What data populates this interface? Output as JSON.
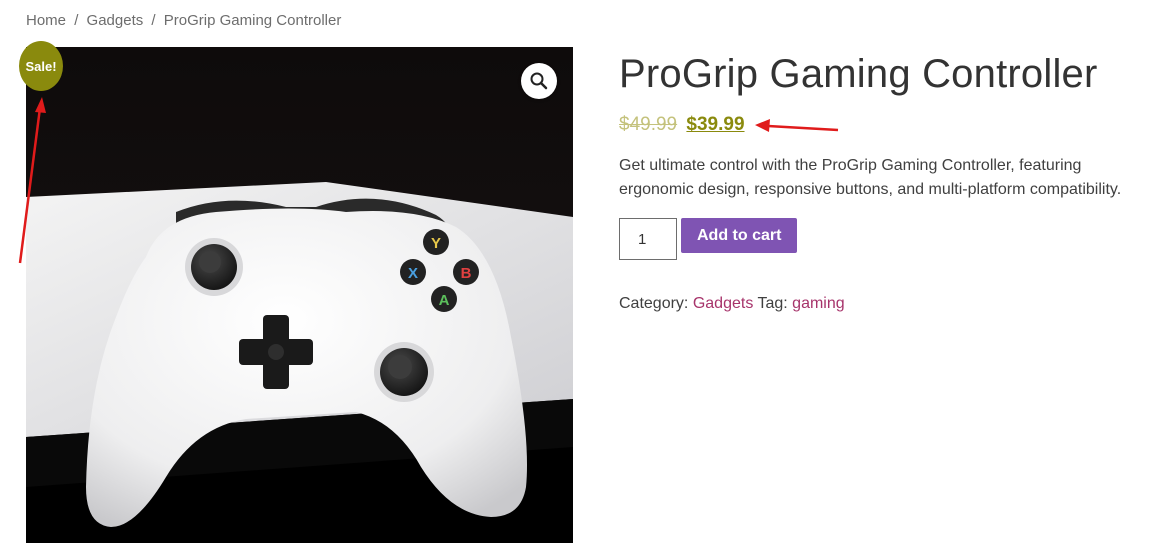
{
  "breadcrumb": {
    "home": "Home",
    "category": "Gadgets",
    "current": "ProGrip Gaming Controller",
    "separator": "/"
  },
  "sale_badge": "Sale!",
  "product": {
    "title": "ProGrip Gaming Controller",
    "regular_price": "$49.99",
    "sale_price": "$39.99",
    "description": "Get ultimate control with the ProGrip Gaming Controller, featuring ergonomic design, responsive buttons, and multi-platform compatibility.",
    "quantity": "1",
    "add_to_cart_label": "Add to cart",
    "category_label": "Category:",
    "category": "Gadgets",
    "tag_label": "Tag:",
    "tag": "gaming"
  },
  "icons": {
    "zoom": "magnifier-icon"
  },
  "colors": {
    "sale": "#8a8a0d",
    "regular_price": "#c4c27c",
    "add_to_cart": "#7f54b3",
    "link": "#a7346b",
    "annotation_arrow": "#e01b1b"
  }
}
